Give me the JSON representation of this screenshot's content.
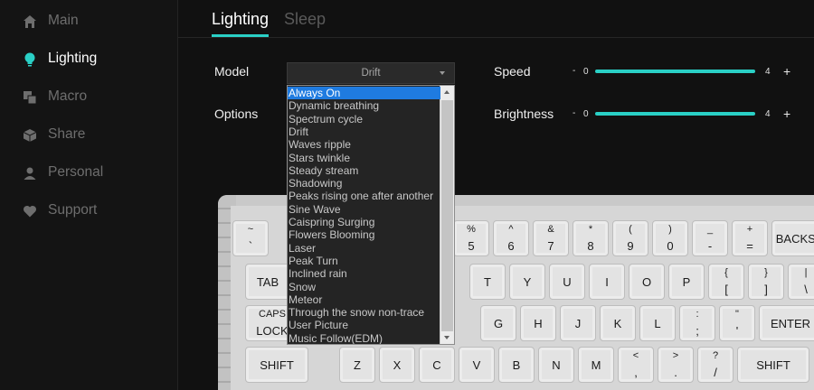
{
  "sidebar": {
    "items": [
      {
        "label": "Main",
        "icon": "home-icon"
      },
      {
        "label": "Lighting",
        "icon": "bulb-icon"
      },
      {
        "label": "Macro",
        "icon": "macro-icon"
      },
      {
        "label": "Share",
        "icon": "cube-icon"
      },
      {
        "label": "Personal",
        "icon": "person-icon"
      },
      {
        "label": "Support",
        "icon": "heart-icon"
      }
    ],
    "active_index": 1
  },
  "tabs": [
    {
      "label": "Lighting",
      "active": true
    },
    {
      "label": "Sleep",
      "active": false
    }
  ],
  "settings": {
    "model_label": "Model",
    "options_label": "Options",
    "speed_label": "Speed",
    "brightness_label": "Brightness",
    "model_value": "Drift",
    "speed": {
      "min_sign": "-",
      "min": "0",
      "max": "4",
      "plus": "+"
    },
    "brightness": {
      "min_sign": "-",
      "min": "0",
      "max": "4",
      "plus": "+"
    }
  },
  "dropdown": {
    "selected": "Always On",
    "options": [
      "Always On",
      "Dynamic breathing",
      "Spectrum cycle",
      "Drift",
      "Waves ripple",
      "Stars twinkle",
      "Steady stream",
      "Shadowing",
      "Peaks rising one after another",
      "Sine Wave",
      "Caispring Surging",
      "Flowers Blooming",
      "Laser",
      "Peak Turn",
      "Inclined rain",
      "Snow",
      "Meteor",
      "Through the snow non-trace",
      "User Picture",
      "Music Follow(EDM)"
    ]
  },
  "keyboard": {
    "row1": [
      {
        "top": "~",
        "bot": "`"
      },
      {
        "top": "%",
        "bot": "5"
      },
      {
        "top": "^",
        "bot": "6"
      },
      {
        "top": "&",
        "bot": "7"
      },
      {
        "top": "*",
        "bot": "8"
      },
      {
        "top": "(",
        "bot": "9"
      },
      {
        "top": ")",
        "bot": "0"
      },
      {
        "top": "_",
        "bot": "-"
      },
      {
        "top": "+",
        "bot": "="
      },
      {
        "single": "BACKSPA"
      }
    ],
    "row2": [
      {
        "single": "TAB"
      },
      {
        "single": "T"
      },
      {
        "single": "Y"
      },
      {
        "single": "U"
      },
      {
        "single": "I"
      },
      {
        "single": "O"
      },
      {
        "single": "P"
      },
      {
        "top": "{",
        "bot": "["
      },
      {
        "top": "}",
        "bot": "]"
      },
      {
        "top": "|",
        "bot": "\\"
      }
    ],
    "row3": [
      {
        "top": "CAPS",
        "bot": "LOCK"
      },
      {
        "single": "G"
      },
      {
        "single": "H"
      },
      {
        "single": "J"
      },
      {
        "single": "K"
      },
      {
        "single": "L"
      },
      {
        "top": ":",
        "bot": ";"
      },
      {
        "top": "\"",
        "bot": "'"
      },
      {
        "single": "ENTER"
      }
    ],
    "row4": [
      {
        "single": "SHIFT"
      },
      {
        "single": "Z"
      },
      {
        "single": "X"
      },
      {
        "single": "C"
      },
      {
        "single": "V"
      },
      {
        "single": "B"
      },
      {
        "single": "N"
      },
      {
        "single": "M"
      },
      {
        "top": "<",
        "bot": ","
      },
      {
        "top": ">",
        "bot": "."
      },
      {
        "top": "?",
        "bot": "/"
      },
      {
        "single": "SHIFT"
      }
    ]
  },
  "colors": {
    "accent": "#2ad0c6",
    "selection": "#1f7be0"
  }
}
